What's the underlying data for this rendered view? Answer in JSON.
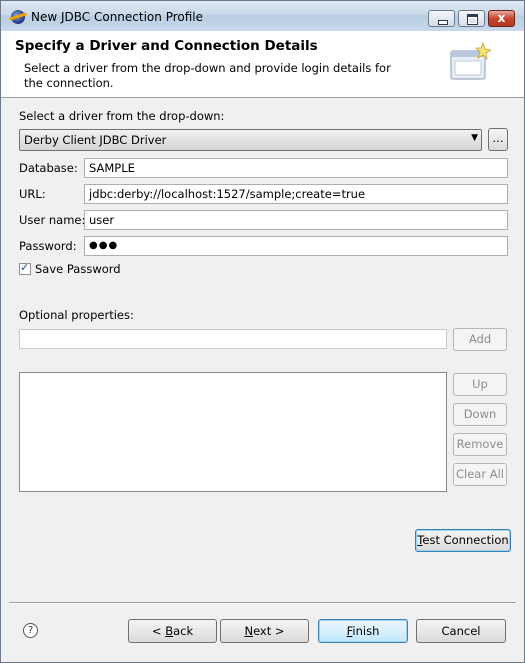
{
  "window": {
    "title": "New JDBC Connection Profile",
    "close_glyph": "x"
  },
  "banner": {
    "heading": "Specify a Driver and Connection Details",
    "description": "Select a driver from the drop-down and provide login details for the connection."
  },
  "driver": {
    "label": "Select a driver from the drop-down:",
    "selected": "Derby Client JDBC Driver",
    "browse_label": "..."
  },
  "form": {
    "database_label": "Database:",
    "database_value": "SAMPLE",
    "url_label": "URL:",
    "url_value": "jdbc:derby://localhost:1527/sample;create=true",
    "username_label": "User name:",
    "username_value": "user",
    "password_label": "Password:",
    "password_value": "●●●",
    "save_password_label": "Save Password",
    "save_password_checked": true
  },
  "optional": {
    "label": "Optional properties:",
    "input_value": "",
    "add_label": "Add",
    "up_label": "Up",
    "down_label": "Down",
    "remove_label": "Remove",
    "clear_all_label": "Clear All"
  },
  "test_connection": {
    "mnemonic": "T",
    "rest": "est Connection"
  },
  "footer": {
    "help_glyph": "?",
    "back_prefix": "< ",
    "back_mnemonic": "B",
    "back_rest": "ack",
    "next_mnemonic": "N",
    "next_rest": "ext >",
    "finish_mnemonic": "F",
    "finish_rest": "inish",
    "cancel_label": "Cancel"
  }
}
